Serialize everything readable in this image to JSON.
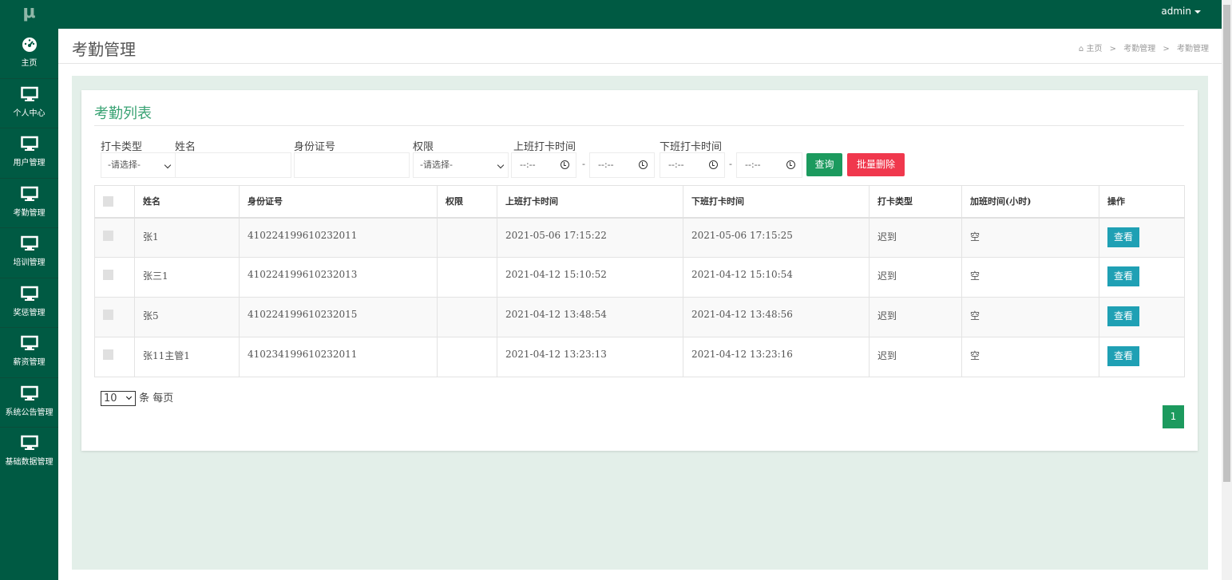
{
  "app": {
    "logo": "μ",
    "user": "admin"
  },
  "sidebar": {
    "items": [
      {
        "label": "主页",
        "icon": "dashboard-icon"
      },
      {
        "label": "个人中心",
        "icon": "monitor-icon"
      },
      {
        "label": "用户管理",
        "icon": "monitor-icon"
      },
      {
        "label": "考勤管理",
        "icon": "monitor-icon"
      },
      {
        "label": "培训管理",
        "icon": "monitor-icon"
      },
      {
        "label": "奖惩管理",
        "icon": "monitor-icon"
      },
      {
        "label": "薪资管理",
        "icon": "monitor-icon"
      },
      {
        "label": "系统公告管理",
        "icon": "monitor-icon"
      },
      {
        "label": "基础数据管理",
        "icon": "monitor-icon"
      }
    ]
  },
  "header": {
    "title": "考勤管理",
    "breadcrumb": [
      "主页",
      "考勤管理",
      "考勤管理"
    ]
  },
  "panel": {
    "title": "考勤列表",
    "filters": {
      "punch_type_label": "打卡类型",
      "punch_type_value": "-请选择-",
      "name_label": "姓名",
      "name_value": "",
      "id_label": "身份证号",
      "id_value": "",
      "perm_label": "权限",
      "perm_value": "-请选择-",
      "in_time_label": "上班打卡时间",
      "out_time_label": "下班打卡时间",
      "time_placeholder": "--:--",
      "dash": "-",
      "search_button": "查询",
      "batch_delete_button": "批量删除"
    },
    "table": {
      "headers": [
        "姓名",
        "身份证号",
        "权限",
        "上班打卡时间",
        "下班打卡时间",
        "打卡类型",
        "加班时间(小时)",
        "操作"
      ],
      "rows": [
        {
          "name": "张1",
          "id": "410224199610232011",
          "perm": "",
          "in": "2021-05-06 17:15:22",
          "out": "2021-05-06 17:15:25",
          "type": "迟到",
          "overtime": "空",
          "action": "查看"
        },
        {
          "name": "张三1",
          "id": "410224199610232013",
          "perm": "",
          "in": "2021-04-12 15:10:52",
          "out": "2021-04-12 15:10:54",
          "type": "迟到",
          "overtime": "空",
          "action": "查看"
        },
        {
          "name": "张5",
          "id": "410224199610232015",
          "perm": "",
          "in": "2021-04-12 13:48:54",
          "out": "2021-04-12 13:48:56",
          "type": "迟到",
          "overtime": "空",
          "action": "查看"
        },
        {
          "name": "张11主管1",
          "id": "410234199610232011",
          "perm": "",
          "in": "2021-04-12 13:23:13",
          "out": "2021-04-12 13:23:16",
          "type": "迟到",
          "overtime": "空",
          "action": "查看"
        }
      ]
    },
    "pagination": {
      "page_size": "10",
      "page_size_suffix": "条 每页",
      "current_page": "1"
    }
  }
}
